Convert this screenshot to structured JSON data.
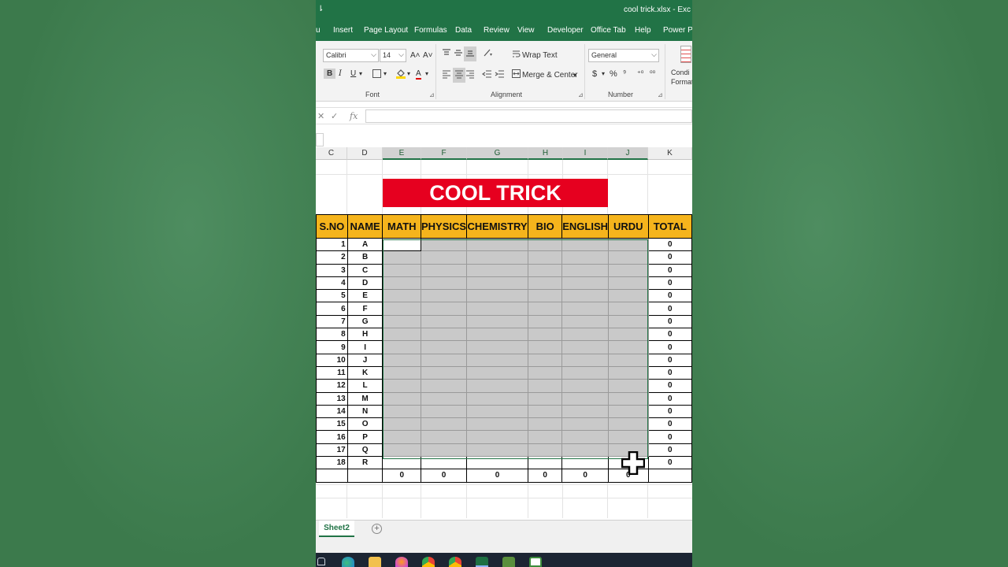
{
  "window": {
    "title": "cool trick.xlsx  -  Exc",
    "qat_glyph": "⇂"
  },
  "ribbon_tabs": [
    "u",
    "Insert",
    "Page Layout",
    "Formulas",
    "Data",
    "Review",
    "View",
    "Developer",
    "Office Tab",
    "Help",
    "Power Piv"
  ],
  "ribbon": {
    "font_name": "Calibri",
    "font_size": "14",
    "grow_font": "A˄",
    "shrink_font": "A˅",
    "bold": "B",
    "italic": "I",
    "underline": "U",
    "font_color": "A",
    "wrap_text": "Wrap Text",
    "merge_center": "Merge & Center",
    "number_format": "General",
    "currency": "$",
    "percent": "%",
    "comma": "⁹",
    "inc_decimal": "⁺⁰",
    "dec_decimal": "⁰⁰",
    "conditional_format": "Condi Format",
    "group_font": "Font",
    "group_alignment": "Alignment",
    "group_number": "Number",
    "colors": {
      "fill_highlight": "#ffd700",
      "font_color": "#e00000"
    }
  },
  "formula_bar": {
    "cancel": "✕",
    "enter": "✓",
    "fx": "fx",
    "value": ""
  },
  "column_headers": [
    "C",
    "D",
    "E",
    "F",
    "G",
    "H",
    "I",
    "J",
    "K"
  ],
  "banner": {
    "title": "COOL TRICK",
    "color": "#e6001f"
  },
  "table": {
    "headers": [
      "S.NO",
      "NAME",
      "MATH",
      "PHYSICS",
      "CHEMISTRY",
      "BIO",
      "ENGLISH",
      "URDU",
      "TOTAL"
    ],
    "header_color": "#f5b41c",
    "rows": [
      {
        "sno": "1",
        "name": "A",
        "total": "0"
      },
      {
        "sno": "2",
        "name": "B",
        "total": "0"
      },
      {
        "sno": "3",
        "name": "C",
        "total": "0"
      },
      {
        "sno": "4",
        "name": "D",
        "total": "0"
      },
      {
        "sno": "5",
        "name": "E",
        "total": "0"
      },
      {
        "sno": "6",
        "name": "F",
        "total": "0"
      },
      {
        "sno": "7",
        "name": "G",
        "total": "0"
      },
      {
        "sno": "8",
        "name": "H",
        "total": "0"
      },
      {
        "sno": "9",
        "name": "I",
        "total": "0"
      },
      {
        "sno": "10",
        "name": "J",
        "total": "0"
      },
      {
        "sno": "11",
        "name": "K",
        "total": "0"
      },
      {
        "sno": "12",
        "name": "L",
        "total": "0"
      },
      {
        "sno": "13",
        "name": "M",
        "total": "0"
      },
      {
        "sno": "14",
        "name": "N",
        "total": "0"
      },
      {
        "sno": "15",
        "name": "O",
        "total": "0"
      },
      {
        "sno": "16",
        "name": "P",
        "total": "0"
      },
      {
        "sno": "17",
        "name": "Q",
        "total": "0"
      },
      {
        "sno": "18",
        "name": "R",
        "total": "0"
      }
    ],
    "footer_totals": [
      "0",
      "0",
      "0",
      "0",
      "0",
      "0"
    ],
    "selection_color": "#c9c9c9"
  },
  "sheets": {
    "active": "Sheet2",
    "add_label": "+"
  },
  "taskbar_icons": [
    "task-view-icon",
    "edge-icon",
    "file-explorer-icon",
    "firefox-icon",
    "chrome-icon",
    "chrome-icon-2",
    "excel-icon",
    "app-icon",
    "notepad-icon"
  ]
}
